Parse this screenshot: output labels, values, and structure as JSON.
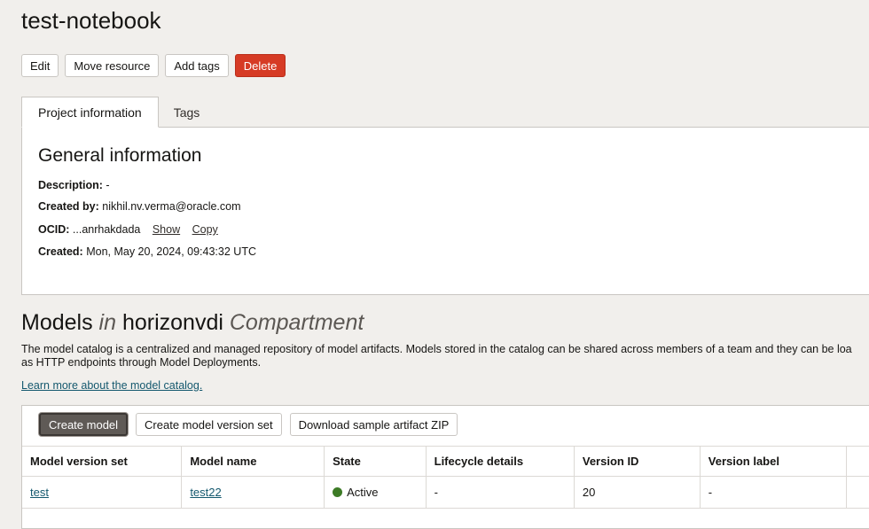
{
  "header": {
    "title": "test-notebook",
    "actions": [
      "Edit",
      "Move resource",
      "Add tags",
      "Delete"
    ]
  },
  "tabs": [
    {
      "label": "Project information",
      "active": true
    },
    {
      "label": "Tags",
      "active": false
    }
  ],
  "general": {
    "heading": "General information",
    "description_label": "Description:",
    "description_value": "-",
    "created_by_label": "Created by:",
    "created_by_value": "nikhil.nv.verma@oracle.com",
    "ocid_label": "OCID:",
    "ocid_value": "...anrhakdada",
    "ocid_show": "Show",
    "ocid_copy": "Copy",
    "created_label": "Created:",
    "created_value": "Mon, May 20, 2024, 09:43:32 UTC"
  },
  "models": {
    "title_main": "Models",
    "title_in": "in",
    "title_compartment": "horizonvdi",
    "title_suffix": "Compartment",
    "description_line1": "The model catalog is a centralized and managed repository of model artifacts. Models stored in the catalog can be shared across members of a team and they can be loa",
    "description_line2": "as HTTP endpoints through Model Deployments.",
    "learn_more": "Learn more about the model catalog.",
    "table_actions": [
      "Create model",
      "Create model version set",
      "Download sample artifact ZIP"
    ],
    "columns": [
      "Model version set",
      "Model name",
      "State",
      "Lifecycle details",
      "Version ID",
      "Version label"
    ],
    "rows": [
      {
        "version_set": "test",
        "model_name": "test22",
        "state": "Active",
        "lifecycle": "-",
        "version_id": "20",
        "version_label": "-"
      }
    ]
  },
  "colors": {
    "danger": "#d63b25",
    "link": "#14586e",
    "active_status": "#3d7b26"
  }
}
